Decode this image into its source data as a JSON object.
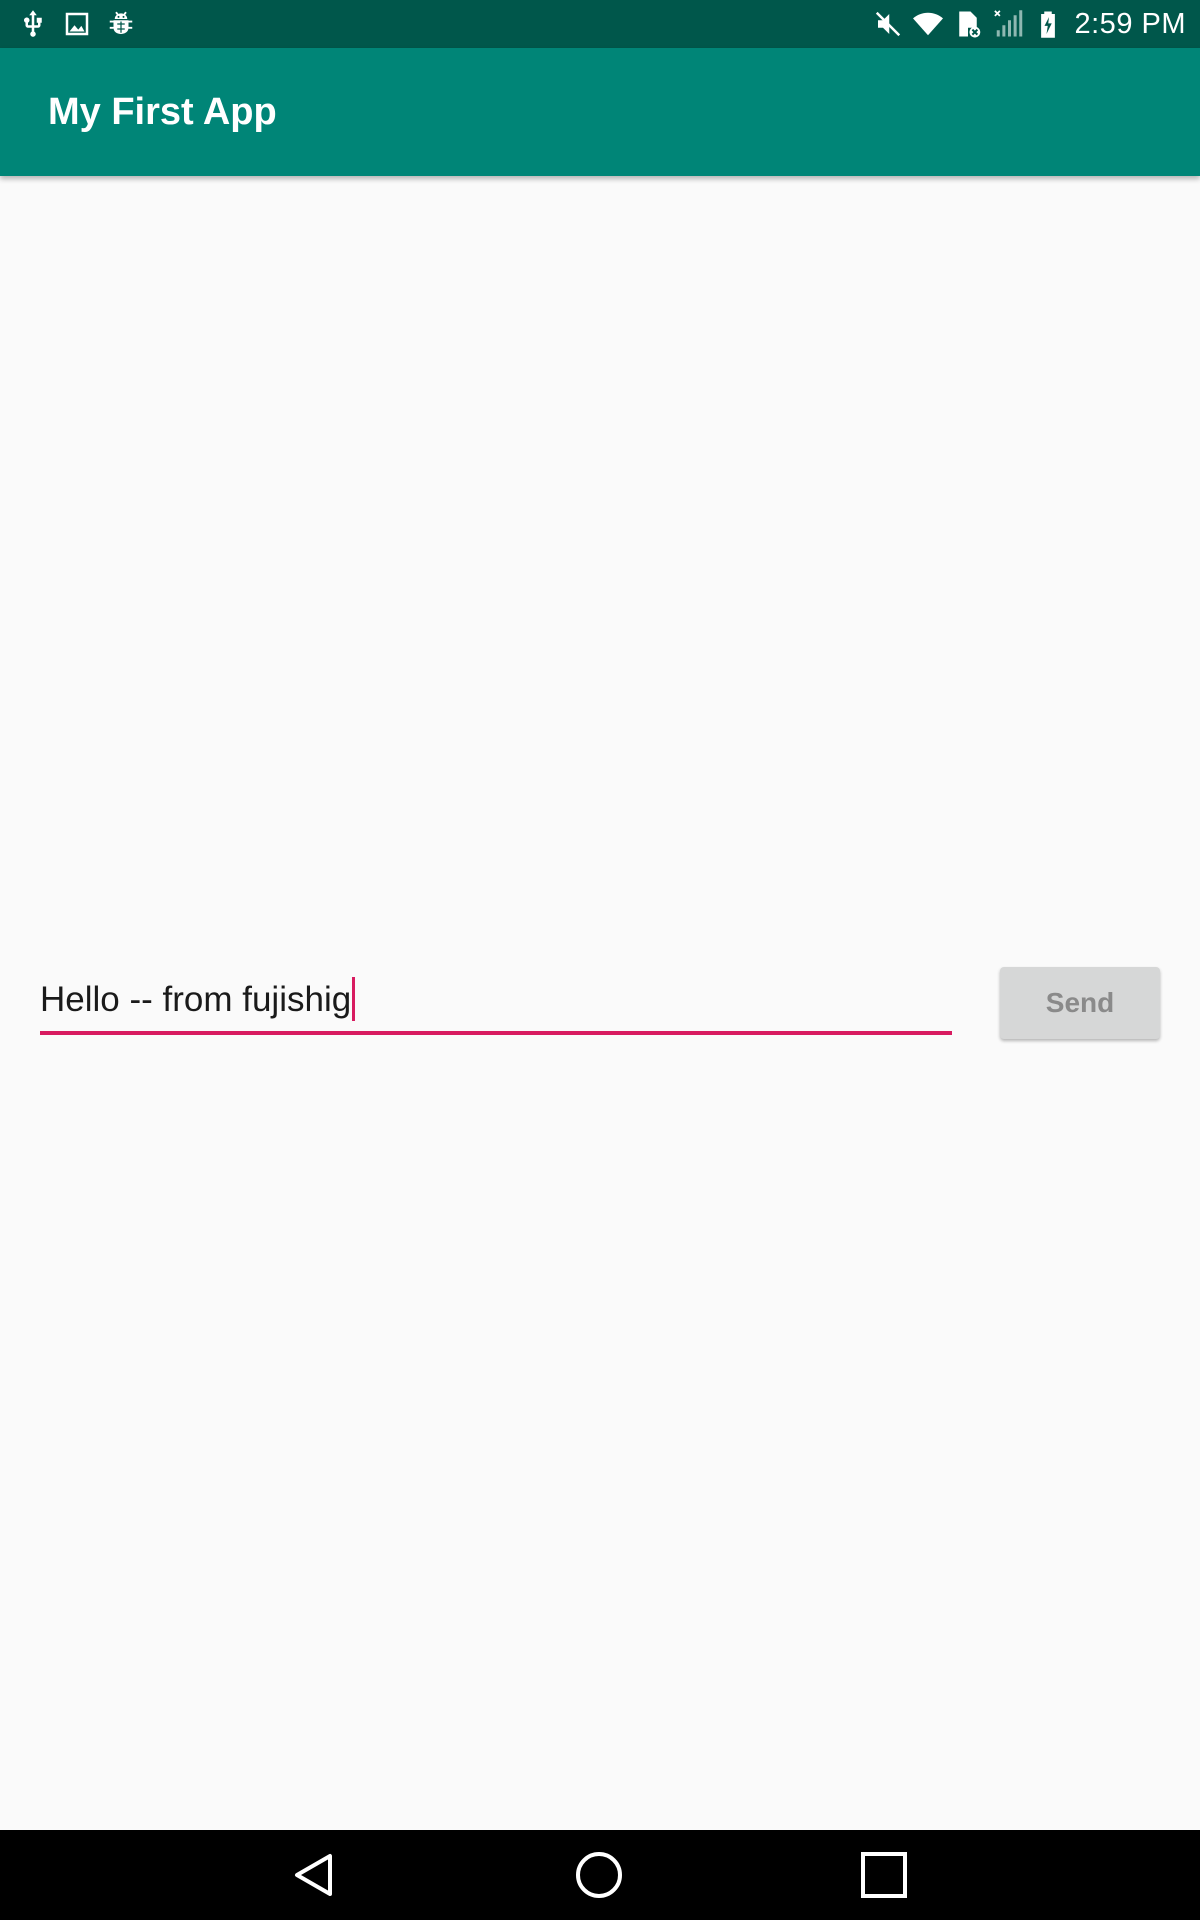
{
  "status_bar": {
    "left_icons": [
      "usb-icon",
      "image-icon",
      "android-debug-icon"
    ],
    "right_icons": [
      "mute-icon",
      "wifi-icon",
      "sim-blocked-icon",
      "cell-signal-icon",
      "battery-charging-icon"
    ],
    "time": "2:59 PM",
    "background_color": "#00574b"
  },
  "app_bar": {
    "title": "My First App",
    "background_color": "#008577"
  },
  "content": {
    "message_input": {
      "value": "Hello -- from fujishig",
      "accent_color": "#d81b60"
    },
    "send_button": {
      "label": "Send",
      "enabled": false
    }
  },
  "nav_bar": {
    "buttons": [
      "back-icon",
      "home-icon",
      "recents-icon"
    ]
  }
}
